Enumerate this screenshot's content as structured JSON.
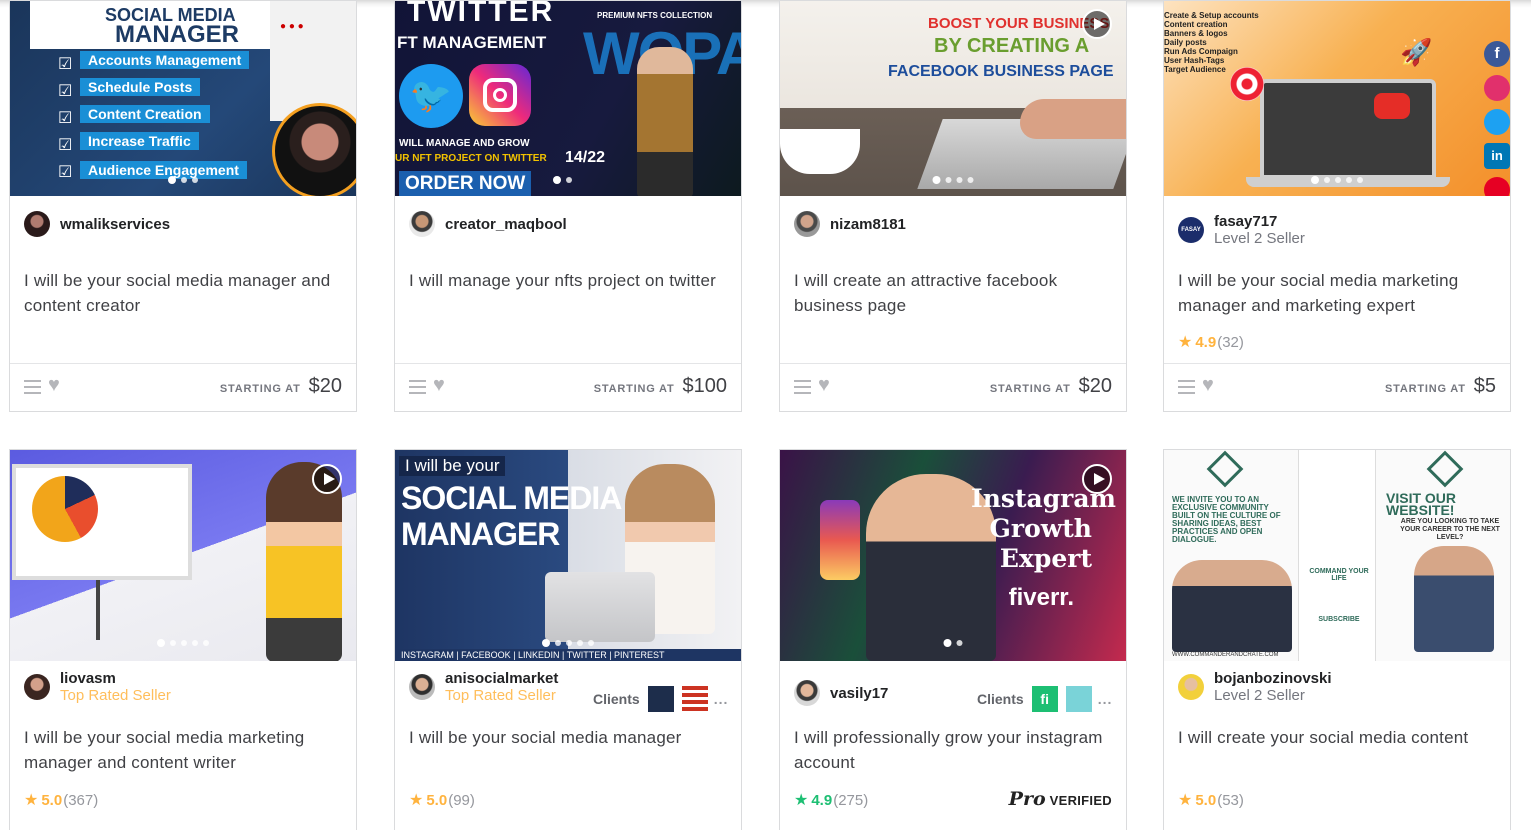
{
  "cards": [
    {
      "seller_name": "wmalikservices",
      "seller_level": "",
      "title": "I will be your social media manager and content creator",
      "starting_label": "STARTING AT",
      "price": "$20",
      "thumb_lines": [
        "SOCIAL MEDIA",
        "MANAGER",
        "Accounts Management",
        "Schedule Posts",
        "Content Creation",
        "Increase Traffic",
        "Audience Engagement"
      ]
    },
    {
      "seller_name": "creator_maqbool",
      "seller_level": "",
      "title": "I will manage your nfts project on twitter",
      "starting_label": "STARTING AT",
      "price": "$100",
      "thumb_lines": [
        "TWITTER",
        "FT MANAGEMENT",
        "PREMIUM NFTS COLLECTION",
        "WOPA",
        "WILL MANAGE AND GROW",
        "UR NFT PROJECT ON TWITTER",
        "14/22",
        "ORDER NOW"
      ]
    },
    {
      "seller_name": "nizam8181",
      "seller_level": "",
      "title": "I will create an attractive facebook business page",
      "starting_label": "STARTING AT",
      "price": "$20",
      "thumb_lines": [
        "BOOST YOUR BUSINESS",
        "BY CREATING A",
        "FACEBOOK BUSINESS PAGE"
      ]
    },
    {
      "seller_name": "fasay717",
      "seller_level": "Level 2 Seller",
      "title": "I will be your social media marketing manager and marketing expert",
      "rating_score": "4.9",
      "rating_count": "(32)",
      "starting_label": "STARTING AT",
      "price": "$5",
      "thumb_lines": [
        "Create & Setup accounts",
        "Content creation",
        "Banners & logos",
        "Daily posts",
        "Run Ads Compaign",
        "User Hash-Tags",
        "Target Audience"
      ]
    },
    {
      "seller_name": "liovasm",
      "seller_level": "Top Rated Seller",
      "title": "I will be your social media marketing manager and content writer",
      "rating_score": "5.0",
      "rating_count": "(367)"
    },
    {
      "seller_name": "anisocialmarket",
      "seller_level": "Top Rated Seller",
      "title": "I will be your social media manager",
      "rating_score": "5.0",
      "rating_count": "(99)",
      "clients_label": "Clients",
      "more_label": "...",
      "thumb_lines": [
        "I will be your",
        "SOCIAL MEDIA",
        "MANAGER",
        "INSTAGRAM | FACEBOOK | LINKEDIN | TWITTER | PINTEREST"
      ]
    },
    {
      "seller_name": "vasily17",
      "seller_level": "",
      "title": "I will professionally grow your instagram account",
      "rating_score": "4.9",
      "rating_count": "(275)",
      "clients_label": "Clients",
      "more_label": "...",
      "pro_label": "Pro",
      "verified_label": "VERIFIED",
      "thumb_lines": [
        "Instagram",
        "Growth",
        "Expert",
        "fiverr."
      ]
    },
    {
      "seller_name": "bojanbozinovski",
      "seller_level": "Level 2 Seller",
      "title": "I will create your social media content",
      "rating_score": "5.0",
      "rating_count": "(53)",
      "thumb_lines": [
        "WE INVITE YOU TO AN EXCLUSIVE COMMUNITY BUILT ON THE CULTURE OF SHARING IDEAS, BEST PRACTICES AND OPEN DIALOGUE.",
        "VISIT OUR WEBSITE!",
        "ARE YOU LOOKING TO TAKE YOUR CAREER TO THE NEXT LEVEL?",
        "COMMAND YOUR LIFE",
        "SUBSCRIBE",
        "WWW.COMMANDERANDCRATE.COM"
      ]
    }
  ],
  "colors": {
    "accent_star": "#ffb33e",
    "pro_star": "#1dbf73",
    "top_rated": "#ffbe5b",
    "border": "#dadbdd"
  }
}
